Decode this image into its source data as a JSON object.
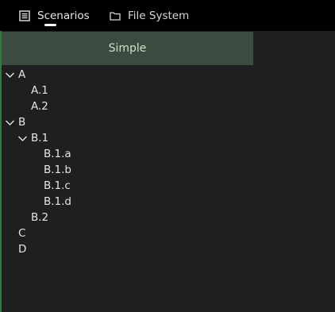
{
  "tabs": [
    {
      "label": "Scenarios",
      "icon": "list-icon",
      "active": true
    },
    {
      "label": "File System",
      "icon": "folder-icon",
      "active": false
    }
  ],
  "header": {
    "label": "Simple"
  },
  "tree": [
    {
      "label": "A",
      "expanded": true
    },
    {
      "label": "A.1"
    },
    {
      "label": "A.2"
    },
    {
      "label": "B",
      "expanded": true
    },
    {
      "label": "B.1",
      "expanded": true
    },
    {
      "label": "B.1.a"
    },
    {
      "label": "B.1.b"
    },
    {
      "label": "B.1.c"
    },
    {
      "label": "B.1.d"
    },
    {
      "label": "B.2"
    },
    {
      "label": "C"
    },
    {
      "label": "D"
    }
  ],
  "colors": {
    "topbar": "#000000",
    "panel": "#1f1f22",
    "header_bg": "#3c4a3f",
    "header_text": "#c7e0c9",
    "accent": "#2f7d3a"
  }
}
